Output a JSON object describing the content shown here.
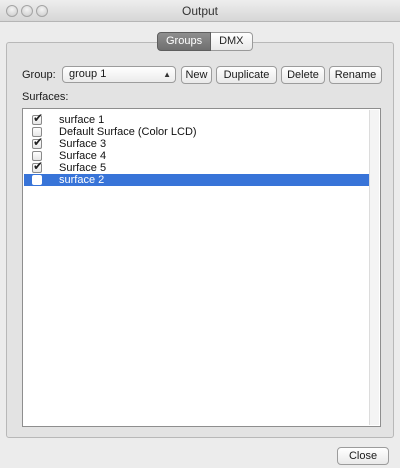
{
  "window": {
    "title": "Output"
  },
  "tabs": [
    {
      "label": "Groups",
      "active": true
    },
    {
      "label": "DMX",
      "active": false
    }
  ],
  "group": {
    "label": "Group:",
    "selected": "group 1",
    "buttons": {
      "new": "New",
      "duplicate": "Duplicate",
      "delete": "Delete",
      "rename": "Rename"
    }
  },
  "surfaces": {
    "label": "Surfaces:",
    "items": [
      {
        "label": "surface 1",
        "checked": true,
        "selected": false
      },
      {
        "label": "Default Surface (Color LCD)",
        "checked": false,
        "selected": false
      },
      {
        "label": "Surface 3",
        "checked": true,
        "selected": false
      },
      {
        "label": "Surface 4",
        "checked": false,
        "selected": false
      },
      {
        "label": "Surface 5",
        "checked": true,
        "selected": false
      },
      {
        "label": "surface 2",
        "checked": false,
        "selected": true
      }
    ]
  },
  "footer": {
    "close": "Close"
  },
  "colors": {
    "selection": "#3874d8"
  }
}
